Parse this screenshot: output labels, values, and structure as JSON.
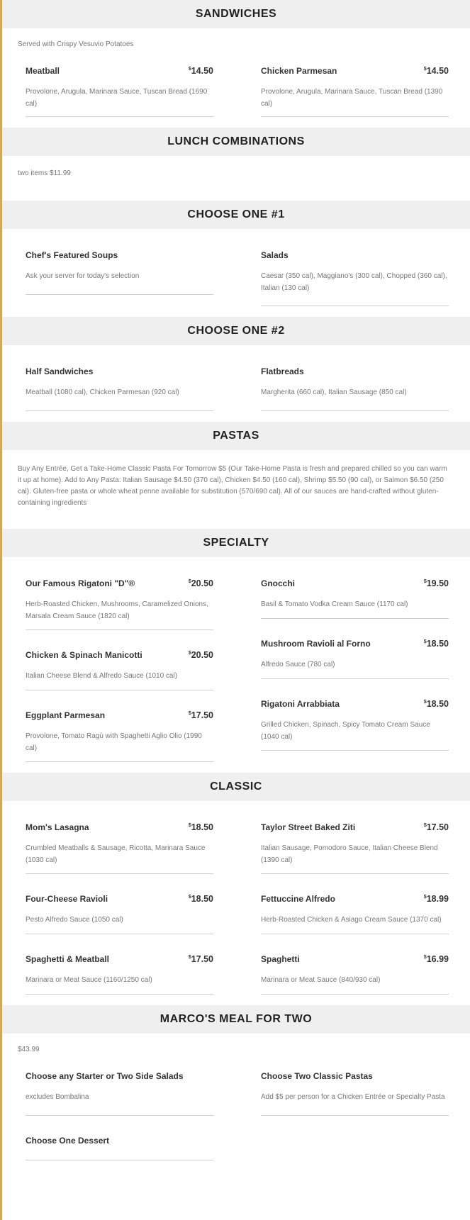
{
  "sections": {
    "sandwiches": {
      "title": "SANDWICHES",
      "desc": "Served with Crispy Vesuvio Potatoes",
      "items": [
        {
          "name": "Meatball",
          "currency": "$",
          "price": "14.50",
          "desc": "Provolone, Arugula, Marinara Sauce, Tuscan Bread (1690 cal)"
        },
        {
          "name": "Chicken Parmesan",
          "currency": "$",
          "price": "14.50",
          "desc": "Provolone, Arugula, Marinara Sauce, Tuscan Bread (1390 cal)"
        }
      ]
    },
    "lunch": {
      "title": "LUNCH COMBINATIONS",
      "desc": "two items $11.99"
    },
    "choose1": {
      "title": "CHOOSE ONE #1",
      "items": [
        {
          "name": "Chef's Featured Soups",
          "desc": "Ask your server for today's selection"
        },
        {
          "name": "Salads",
          "desc": "Caesar (350 cal), Maggiano's (300 cal), Chopped (360 cal), Italian (130 cal)"
        }
      ]
    },
    "choose2": {
      "title": "CHOOSE ONE #2",
      "items": [
        {
          "name": "Half Sandwiches",
          "desc": "Meatball (1080 cal), Chicken Parmesan (920 cal)"
        },
        {
          "name": "Flatbreads",
          "desc": "Margherita (660 cal), Italian Sausage (850 cal)"
        }
      ]
    },
    "pastas": {
      "title": "PASTAS",
      "desc": "Buy Any Entrée, Get a Take-Home Classic Pasta For Tomorrow $5 (Our Take-Home Pasta is fresh and prepared chilled so you can warm it up at home). Add to Any Pasta: Italian Sausage $4.50 (370 cal), Chicken $4.50 (160 cal), Shrimp $5.50 (90 cal), or Salmon $6.50 (250 cal). Gluten-free pasta or whole wheat penne available for substitution (570/690 cal). All of our sauces are hand-crafted without gluten-containing ingredients"
    },
    "specialty": {
      "title": "SPECIALTY",
      "left": [
        {
          "name": "Our Famous Rigatoni \"D\"®",
          "currency": "$",
          "price": "20.50",
          "desc": "Herb-Roasted Chicken, Mushrooms, Caramelized Onions, Marsala Cream Sauce (1820 cal)"
        },
        {
          "name": "Chicken & Spinach Manicotti",
          "currency": "$",
          "price": "20.50",
          "desc": "Italian Cheese Blend & Alfredo Sauce (1010 cal)"
        },
        {
          "name": "Eggplant Parmesan",
          "currency": "$",
          "price": "17.50",
          "desc": "Provolone, Tomato Ragù with Spaghetti Aglio Olio (1990 cal)"
        }
      ],
      "right": [
        {
          "name": "Gnocchi",
          "currency": "$",
          "price": "19.50",
          "desc": "Basil & Tomato Vodka Cream Sauce (1170 cal)"
        },
        {
          "name": "Mushroom Ravioli al Forno",
          "currency": "$",
          "price": "18.50",
          "desc": "Alfredo Sauce (780 cal)"
        },
        {
          "name": "Rigatoni Arrabbiata",
          "currency": "$",
          "price": "18.50",
          "desc": "Grilled Chicken, Spinach, Spicy Tomato Cream Sauce (1040 cal)"
        }
      ]
    },
    "classic": {
      "title": "CLASSIC",
      "left": [
        {
          "name": "Mom's Lasagna",
          "currency": "$",
          "price": "18.50",
          "desc": "Crumbled Meatballs & Sausage, Ricotta, Marinara Sauce (1030 cal)"
        },
        {
          "name": "Four-Cheese Ravioli",
          "currency": "$",
          "price": "18.50",
          "desc": "Pesto Alfredo Sauce (1050 cal)"
        },
        {
          "name": "Spaghetti & Meatball",
          "currency": "$",
          "price": "17.50",
          "desc": "Marinara or Meat Sauce (1160/1250 cal)"
        }
      ],
      "right": [
        {
          "name": "Taylor Street Baked Ziti",
          "currency": "$",
          "price": "17.50",
          "desc": "Italian Sausage, Pomodoro Sauce, Italian Cheese Blend (1390 cal)"
        },
        {
          "name": "Fettuccine Alfredo",
          "currency": "$",
          "price": "18.99",
          "desc": "Herb-Roasted Chicken & Asiago Cream Sauce (1370 cal)"
        },
        {
          "name": "Spaghetti",
          "currency": "$",
          "price": "16.99",
          "desc": "Marinara or Meat Sauce (840/930 cal)"
        }
      ]
    },
    "mealfortwo": {
      "title": "MARCO'S MEAL FOR TWO",
      "desc": "$43.99",
      "items": [
        {
          "name": "Choose any Starter or Two Side Salads",
          "desc": "excludes Bombalina"
        },
        {
          "name": "Choose Two Classic Pastas",
          "desc": "Add $5 per person for a Chicken Entrée or Specialty Pasta"
        },
        {
          "name": "Choose One Dessert"
        }
      ]
    }
  },
  "colors": {
    "accent_border": "#d4a85b",
    "header_bg": "#efefef"
  }
}
